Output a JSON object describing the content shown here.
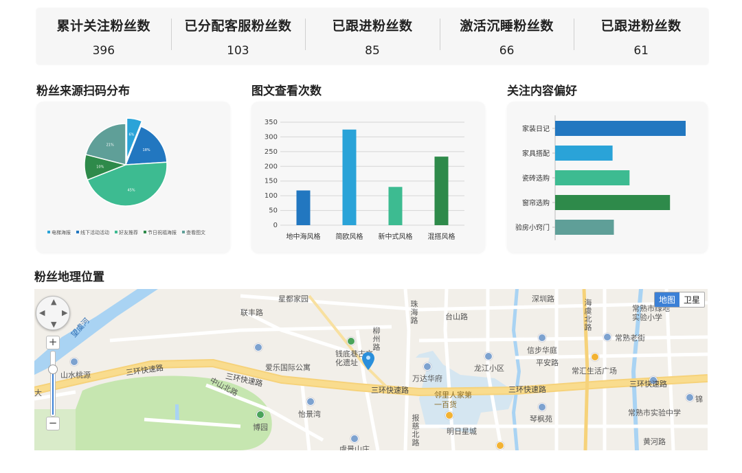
{
  "stats": [
    {
      "label": "累计关注粉丝数",
      "value": "396"
    },
    {
      "label": "已分配客服粉丝数",
      "value": "103"
    },
    {
      "label": "已跟进粉丝数",
      "value": "85"
    },
    {
      "label": "激活沉睡粉丝数",
      "value": "66"
    },
    {
      "label": "已跟进粉丝数",
      "value": "61"
    }
  ],
  "sections": {
    "source": "粉丝来源扫码分布",
    "views": "图文查看次数",
    "preference": "关注内容偏好",
    "geo": "粉丝地理位置"
  },
  "chart_data": [
    {
      "type": "pie",
      "categories": [
        "电梯海报",
        "线下活动活动",
        "好友推荐",
        "节日祝福海报",
        "查看图文"
      ],
      "values": [
        6,
        18,
        45,
        10,
        21
      ],
      "labels": [
        "6%",
        "18%",
        "45%",
        "10%",
        "21%"
      ],
      "colors": [
        "#2aa3d8",
        "#2277c0",
        "#3dbb91",
        "#2e8a4a",
        "#5f9f98"
      ],
      "legend": "bottom"
    },
    {
      "type": "bar",
      "categories": [
        "地中海风格",
        "简欧风格",
        "新中式风格",
        "混搭风格"
      ],
      "values": [
        118,
        325,
        130,
        233
      ],
      "colors": [
        "#2277c0",
        "#2aa3d8",
        "#3dbb91",
        "#2e8a4a"
      ],
      "yticks": [
        0,
        50,
        100,
        150,
        200,
        250,
        300,
        350
      ],
      "ylim": [
        0,
        350
      ],
      "grid": true
    },
    {
      "type": "bar",
      "orientation": "horizontal",
      "categories": [
        "家装日记",
        "家具搭配",
        "瓷砖选购",
        "窗帘选购",
        "验房小窍门"
      ],
      "values": [
        100,
        44,
        57,
        88,
        45
      ],
      "colors": [
        "#2277c0",
        "#2aa3d8",
        "#3dbb91",
        "#2e8a4a",
        "#5f9f98"
      ]
    }
  ],
  "map": {
    "switch": {
      "map": "地图",
      "satellite": "卫星"
    },
    "labels": {
      "l1": "星都家园",
      "l2": "联丰路",
      "l3": "珠海路",
      "l4": "台山路",
      "l5": "深圳路",
      "l6": "海虞北路",
      "l7": "常熟市绿地实验小学",
      "l8": "常熟老街",
      "l9": "信步华庭",
      "l10": "平安路",
      "l11": "常汇生活广场",
      "l12": "龙江小区",
      "l13": "万达华府",
      "l14": "柳州路",
      "l15": "钱底巷古文化遗址",
      "l16": "爱乐国际公寓",
      "l17": "山水桃源",
      "l18": "三环快速路",
      "l19": "三环快速路",
      "l20": "三环快速路",
      "l21": "三环快速路",
      "l22": "三环快速路",
      "l23": "中山北路",
      "l24": "怡景湾",
      "l25": "博园",
      "l26": "邻里人家第一百货",
      "l27": "明日星城",
      "l28": "琴枫苑",
      "l29": "常熟市实验中学",
      "l30": "黄河路",
      "l31": "报慈北路",
      "l32": "虞景山庄",
      "l33": "望虞河",
      "l34": "锦",
      "l35": "大"
    }
  }
}
